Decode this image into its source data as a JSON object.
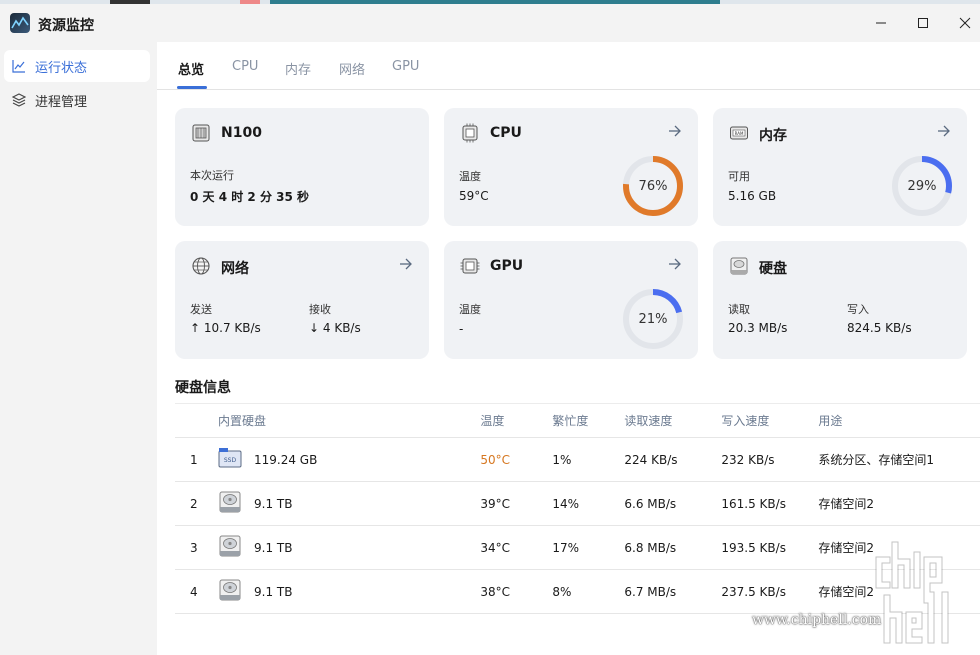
{
  "window": {
    "title": "资源监控"
  },
  "sidebar": {
    "items": [
      {
        "label": "运行状态",
        "icon": "line-chart-icon",
        "active": true
      },
      {
        "label": "进程管理",
        "icon": "layers-icon",
        "active": false
      }
    ]
  },
  "tabs": [
    {
      "label": "总览",
      "active": true
    },
    {
      "label": "CPU",
      "active": false
    },
    {
      "label": "内存",
      "active": false
    },
    {
      "label": "网络",
      "active": false
    },
    {
      "label": "GPU",
      "active": false
    }
  ],
  "cards": {
    "system": {
      "title": "N100",
      "uptime_label": "本次运行",
      "uptime_value": "0 天 4 时 2 分 35 秒"
    },
    "cpu": {
      "title": "CPU",
      "temp_label": "温度",
      "temp_value": "59°C",
      "usage_text": "76%",
      "usage": 0.76,
      "color": "#e07a2a"
    },
    "memory": {
      "title": "内存",
      "avail_label": "可用",
      "avail_value": "5.16 GB",
      "usage_text": "29%",
      "usage": 0.29,
      "color": "#4b6ef0"
    },
    "network": {
      "title": "网络",
      "send_label": "发送",
      "send_value": "10.7 KB/s",
      "recv_label": "接收",
      "recv_value": "4 KB/s"
    },
    "gpu": {
      "title": "GPU",
      "temp_label": "温度",
      "temp_value": "-",
      "usage_text": "21%",
      "usage": 0.21,
      "color": "#4b6ef0"
    },
    "disk": {
      "title": "硬盘",
      "read_label": "读取",
      "read_value": "20.3 MB/s",
      "write_label": "写入",
      "write_value": "824.5 KB/s"
    }
  },
  "disk_info": {
    "title": "硬盘信息",
    "headers": [
      "内置硬盘",
      "温度",
      "繁忙度",
      "读取速度",
      "写入速度",
      "用途"
    ],
    "rows": [
      {
        "index": "1",
        "type": "ssd",
        "size": "119.24 GB",
        "temp": "50°C",
        "hot": true,
        "busy": "1%",
        "read": "224 KB/s",
        "write": "232 KB/s",
        "usage": "系统分区、存储空间1"
      },
      {
        "index": "2",
        "type": "hdd",
        "size": "9.1 TB",
        "temp": "39°C",
        "hot": false,
        "busy": "14%",
        "read": "6.6 MB/s",
        "write": "161.5 KB/s",
        "usage": "存储空间2"
      },
      {
        "index": "3",
        "type": "hdd",
        "size": "9.1 TB",
        "temp": "34°C",
        "hot": false,
        "busy": "17%",
        "read": "6.8 MB/s",
        "write": "193.5 KB/s",
        "usage": "存储空间2"
      },
      {
        "index": "4",
        "type": "hdd",
        "size": "9.1 TB",
        "temp": "38°C",
        "hot": false,
        "busy": "8%",
        "read": "6.7 MB/s",
        "write": "237.5 KB/s",
        "usage": "存储空间2"
      }
    ]
  },
  "watermark": {
    "url": "www.chiphell.com"
  },
  "colors": {
    "accent": "#3a6fd8",
    "hot": "#d67720"
  }
}
